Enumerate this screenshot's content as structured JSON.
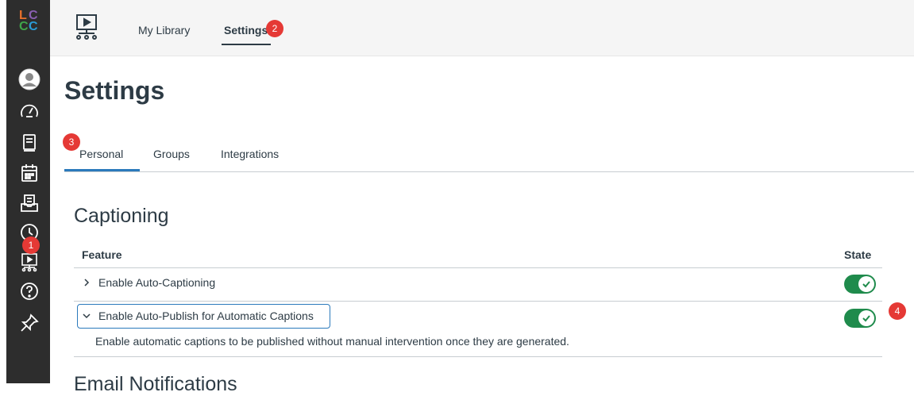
{
  "logo": {
    "letters": [
      "L",
      "C",
      "C",
      "C"
    ]
  },
  "sidebar": {
    "items": [
      {
        "icon": "avatar-icon"
      },
      {
        "icon": "dashboard-icon"
      },
      {
        "icon": "courses-icon"
      },
      {
        "icon": "calendar-icon"
      },
      {
        "icon": "inbox-icon"
      },
      {
        "icon": "history-icon"
      },
      {
        "icon": "studio-icon",
        "badge": "1"
      },
      {
        "icon": "help-icon"
      },
      {
        "icon": "pin-icon"
      }
    ]
  },
  "topbar": {
    "my_library": "My Library",
    "settings": "Settings",
    "settings_badge": "2"
  },
  "page": {
    "title": "Settings"
  },
  "tabs": {
    "badge": "3",
    "items": [
      "Personal",
      "Groups",
      "Integrations"
    ],
    "active": "Personal"
  },
  "captioning": {
    "title": "Captioning",
    "header_feature": "Feature",
    "header_state": "State",
    "rows": [
      {
        "label": "Enable Auto-Captioning",
        "expanded": false,
        "state": "on"
      },
      {
        "label": "Enable Auto-Publish for Automatic Captions",
        "expanded": true,
        "state": "on",
        "description": "Enable automatic captions to be published without manual intervention once they are generated."
      }
    ],
    "toggle_badge": "4"
  },
  "next_section": {
    "title": "Email Notifications"
  },
  "colors": {
    "sidebar": "#2d2d2d",
    "accent": "#2b7abc",
    "toggle_on": "#1f8b4c",
    "badge": "#e53935"
  }
}
